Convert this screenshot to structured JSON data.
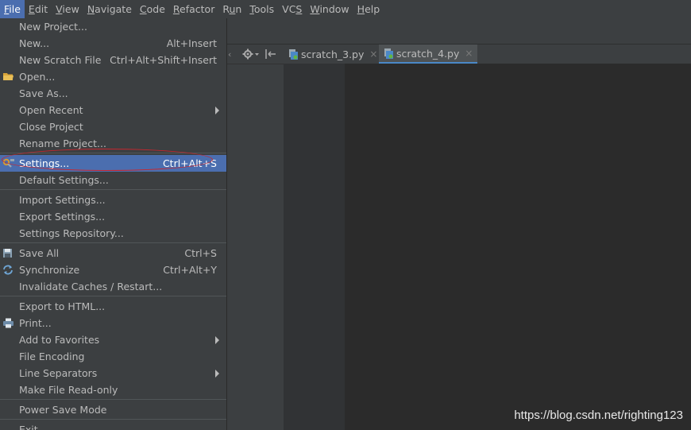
{
  "menubar": {
    "items": [
      {
        "pre": "",
        "u": "F",
        "post": "ile"
      },
      {
        "pre": "",
        "u": "E",
        "post": "dit"
      },
      {
        "pre": "",
        "u": "V",
        "post": "iew"
      },
      {
        "pre": "",
        "u": "N",
        "post": "avigate"
      },
      {
        "pre": "",
        "u": "C",
        "post": "ode"
      },
      {
        "pre": "",
        "u": "R",
        "post": "efactor"
      },
      {
        "pre": "R",
        "u": "u",
        "post": "n"
      },
      {
        "pre": "",
        "u": "T",
        "post": "ools"
      },
      {
        "pre": "VC",
        "u": "S",
        "post": ""
      },
      {
        "pre": "",
        "u": "W",
        "post": "indow"
      },
      {
        "pre": "",
        "u": "H",
        "post": "elp"
      }
    ]
  },
  "tabs": [
    {
      "label": "scratch_3.py",
      "close": "×"
    },
    {
      "label": "scratch_4.py",
      "close": "×"
    }
  ],
  "file_menu": {
    "items": [
      {
        "label": "New Project...",
        "shortcut": ""
      },
      {
        "label": "New...",
        "shortcut": "Alt+Insert"
      },
      {
        "label": "New Scratch File",
        "shortcut": "Ctrl+Alt+Shift+Insert"
      },
      {
        "label": "Open...",
        "shortcut": "",
        "icon": "folder-icon"
      },
      {
        "label": "Save As...",
        "shortcut": ""
      },
      {
        "label": "Open Recent",
        "shortcut": "",
        "submenu": true
      },
      {
        "label": "Close Project",
        "shortcut": ""
      },
      {
        "label": "Rename Project...",
        "shortcut": ""
      },
      {
        "sep": true
      },
      {
        "label": "Settings...",
        "shortcut": "Ctrl+Alt+S",
        "icon": "wrench-icon",
        "selected": true
      },
      {
        "label": "Default Settings...",
        "shortcut": ""
      },
      {
        "sep": true
      },
      {
        "label": "Import Settings...",
        "shortcut": ""
      },
      {
        "label": "Export Settings...",
        "shortcut": ""
      },
      {
        "label": "Settings Repository...",
        "shortcut": ""
      },
      {
        "sep": true
      },
      {
        "label": "Save All",
        "shortcut": "Ctrl+S",
        "icon": "save-icon"
      },
      {
        "label": "Synchronize",
        "shortcut": "Ctrl+Alt+Y",
        "icon": "sync-icon"
      },
      {
        "label": "Invalidate Caches / Restart...",
        "shortcut": ""
      },
      {
        "sep": true
      },
      {
        "label": "Export to HTML...",
        "shortcut": ""
      },
      {
        "label": "Print...",
        "shortcut": "",
        "icon": "print-icon"
      },
      {
        "label": "Add to Favorites",
        "shortcut": "",
        "submenu": true
      },
      {
        "label": "File Encoding",
        "shortcut": ""
      },
      {
        "label": "Line Separators",
        "shortcut": "",
        "submenu": true
      },
      {
        "label": "Make File Read-only",
        "shortcut": ""
      },
      {
        "sep": true
      },
      {
        "label": "Power Save Mode",
        "shortcut": ""
      },
      {
        "sep": true
      },
      {
        "label": "Exit",
        "shortcut": ""
      }
    ]
  },
  "watermark": "https://blog.csdn.net/righting123",
  "colors": {
    "menu_bg": "#3c3f41",
    "selection": "#4b6eaf",
    "editor_bg": "#2b2b2b",
    "highlight_circle": "#c8262e"
  }
}
